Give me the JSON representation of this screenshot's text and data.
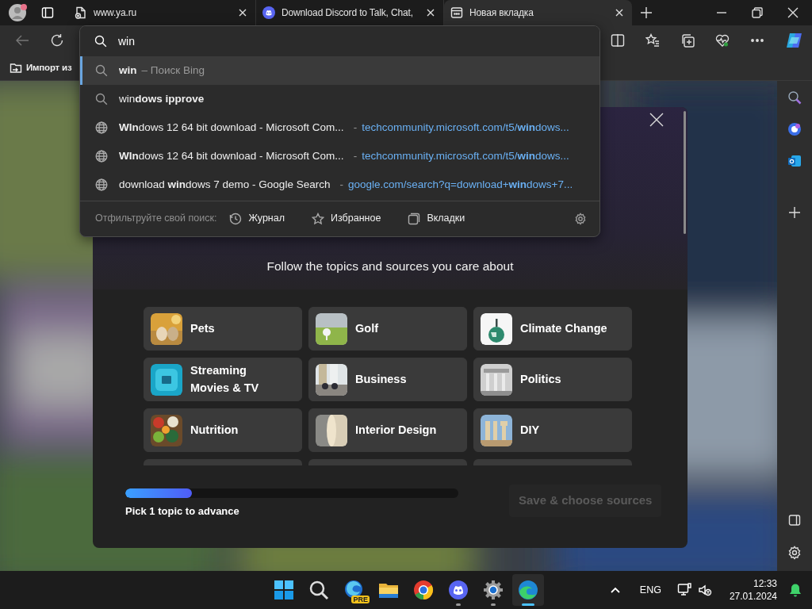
{
  "tabs": [
    {
      "title": "www.ya.ru",
      "selected": false
    },
    {
      "title": "Download Discord to Talk, Chat,",
      "selected": false
    },
    {
      "title": "Новая вкладка",
      "selected": true
    }
  ],
  "bookmarks": [
    {
      "label": "Импорт из"
    }
  ],
  "omnibox": {
    "value": "win",
    "suggestions": [
      {
        "kind": "search",
        "text": "**win**",
        "suffix": "– Поиск Bing",
        "selected": true
      },
      {
        "kind": "search",
        "text": "win**dows ipprove**",
        "selected": false
      },
      {
        "kind": "history",
        "text": "**WIn**dows 12 64 bit download - Microsoft Com...",
        "separator": "-",
        "url": "techcommunity.microsoft.com/t5/**win**dows...",
        "selected": false
      },
      {
        "kind": "history",
        "text": "**WIn**dows 12 64 bit download - Microsoft Com...",
        "separator": "-",
        "url": "techcommunity.microsoft.com/t5/**win**dows...",
        "selected": false
      },
      {
        "kind": "history",
        "text": "download **win**dows 7 demo - Google Search",
        "separator": "-",
        "url": "google.com/search?q=download+**win**dows+7...",
        "selected": false
      }
    ],
    "filter_label": "Отфильтруйте свой поиск:",
    "filters": [
      {
        "kind": "history",
        "label": "Журнал"
      },
      {
        "kind": "favorites",
        "label": "Избранное"
      },
      {
        "kind": "tabs",
        "label": "Вкладки"
      }
    ]
  },
  "onboarding": {
    "subtitle": "Follow the topics and sources you care about",
    "topics": [
      {
        "label": "Pets",
        "selected": false
      },
      {
        "label": "Golf",
        "selected": false
      },
      {
        "label": "Climate Change",
        "selected": false
      },
      {
        "label": "Streaming Movies & TV",
        "selected": false
      },
      {
        "label": "Business",
        "selected": false
      },
      {
        "label": "Politics",
        "selected": false
      },
      {
        "label": "Nutrition",
        "selected": false
      },
      {
        "label": "Interior Design",
        "selected": false
      },
      {
        "label": "DIY",
        "selected": false
      }
    ],
    "progress": {
      "level": 0.2,
      "hint": "Pick 1 topic to advance"
    },
    "action": {
      "label": "Save & choose sources",
      "disabled": true
    }
  },
  "taskbar": {
    "apps": [
      {
        "kind": "start",
        "running": false,
        "active": false
      },
      {
        "kind": "search",
        "running": false,
        "active": false
      },
      {
        "kind": "preview",
        "badge": "PRE",
        "running": false,
        "active": false
      },
      {
        "kind": "folder",
        "running": false,
        "active": false
      },
      {
        "kind": "chrome",
        "running": false,
        "active": false
      },
      {
        "kind": "chat",
        "running": true,
        "active": false
      },
      {
        "kind": "settings",
        "running": true,
        "active": false
      },
      {
        "kind": "edge",
        "running": true,
        "active": true
      }
    ],
    "language": "ENG",
    "time": "12:33",
    "date": "27.01.2024"
  }
}
